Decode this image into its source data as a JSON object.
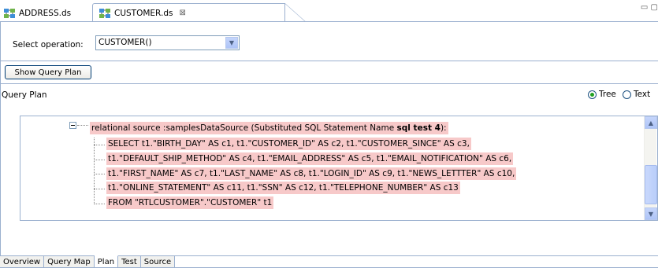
{
  "editor_tabs": [
    {
      "label": "ADDRESS.ds",
      "active": false
    },
    {
      "label": "CUSTOMER.ds",
      "active": true,
      "close": "⊠"
    }
  ],
  "window_controls": "▭ ▢",
  "select_operation": {
    "label": "Select operation:",
    "value": "CUSTOMER()"
  },
  "show_query_plan_label": "Show Query Plan",
  "query_plan": {
    "label": "Query Plan",
    "view_options": [
      {
        "label": "Tree",
        "selected": true
      },
      {
        "label": "Text",
        "selected": false
      }
    ]
  },
  "tree": {
    "root_prefix": "relational source :samplesDataSource (Substituted SQL Statement Name ",
    "root_bold": "sql test 4",
    "root_suffix": "):",
    "lines": [
      "SELECT t1.\"BIRTH_DAY\" AS c1, t1.\"CUSTOMER_ID\" AS c2, t1.\"CUSTOMER_SINCE\" AS c3,",
      " t1.\"DEFAULT_SHIP_METHOD\" AS c4, t1.\"EMAIL_ADDRESS\" AS c5, t1.\"EMAIL_NOTIFICATION\" AS c6,",
      " t1.\"FIRST_NAME\" AS c7, t1.\"LAST_NAME\" AS c8, t1.\"LOGIN_ID\" AS c9, t1.\"NEWS_LETTTER\" AS c10,",
      " t1.\"ONLINE_STATEMENT\" AS c11, t1.\"SSN\" AS c12, t1.\"TELEPHONE_NUMBER\" AS c13",
      "FROM \"RTLCUSTOMER\".\"CUSTOMER\" t1"
    ]
  },
  "bottom_tabs": [
    {
      "label": "Overview",
      "active": false
    },
    {
      "label": "Query Map",
      "active": false
    },
    {
      "label": "Plan",
      "active": true
    },
    {
      "label": "Test",
      "active": false
    },
    {
      "label": "Source",
      "active": false
    }
  ],
  "colors": {
    "highlight": "#f7c9c9",
    "border": "#9bb0cf",
    "radio_selected": "#21a121"
  },
  "icons": {
    "data_service": "ds-icon",
    "close": "close-icon",
    "dropdown": "chevron-down-icon"
  }
}
